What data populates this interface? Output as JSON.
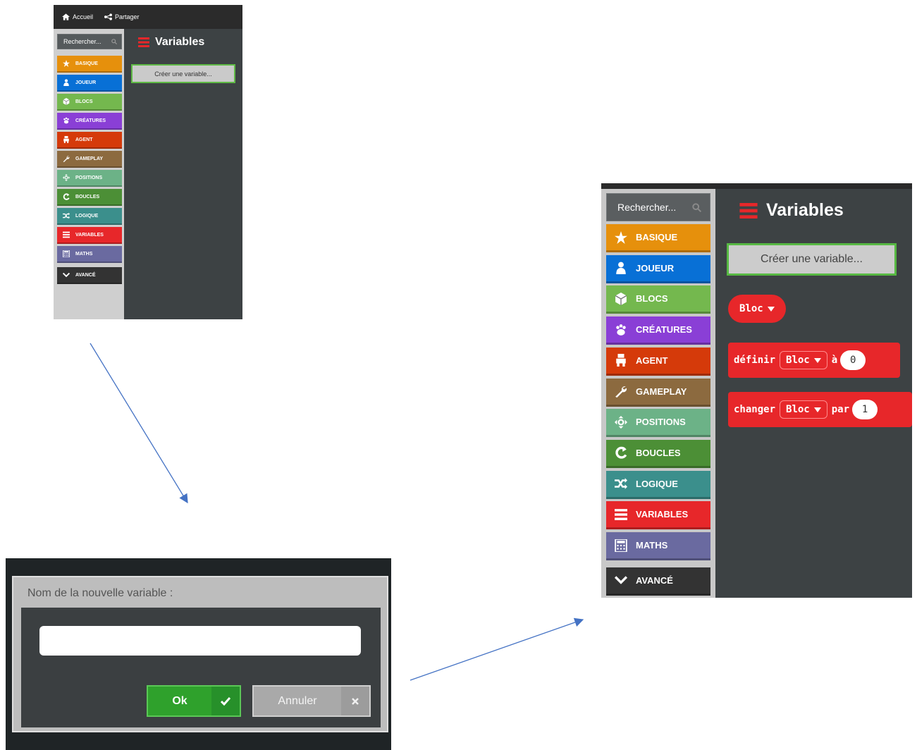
{
  "colors": {
    "basique": "#e6900c",
    "joueur": "#0870d6",
    "blocs": "#74b84e",
    "creatures": "#8a3fd6",
    "agent": "#d53a0a",
    "gameplay": "#8c6a3f",
    "positions": "#6cb287",
    "boucles": "#4c8f36",
    "logique": "#3b8f8c",
    "variables": "#e7272a",
    "maths": "#6a6aa0",
    "avance": "#333333",
    "arrow": "#4472c4"
  },
  "shot1": {
    "topbar": {
      "home_label": "Accueil",
      "share_label": "Partager"
    },
    "search_placeholder": "Rechercher...",
    "categories": [
      {
        "label": "BASIQUE",
        "icon": "star-icon"
      },
      {
        "label": "JOUEUR",
        "icon": "user-icon"
      },
      {
        "label": "BLOCS",
        "icon": "cube-icon"
      },
      {
        "label": "CRÉATURES",
        "icon": "paw-icon"
      },
      {
        "label": "AGENT",
        "icon": "agent-icon"
      },
      {
        "label": "GAMEPLAY",
        "icon": "wrench-icon"
      },
      {
        "label": "POSITIONS",
        "icon": "move-icon"
      },
      {
        "label": "BOUCLES",
        "icon": "loop-icon"
      },
      {
        "label": "LOGIQUE",
        "icon": "shuffle-icon"
      },
      {
        "label": "VARIABLES",
        "icon": "list-icon"
      },
      {
        "label": "MATHS",
        "icon": "calculator-icon"
      },
      {
        "label": "AVANCÉ",
        "icon": "chevron-down-icon"
      }
    ],
    "flyout_title": "Variables",
    "create_button": "Créer une variable..."
  },
  "shot2": {
    "dialog_title": "Nom de la nouvelle variable :",
    "input_value": "",
    "ok_label": "Ok",
    "cancel_label": "Annuler"
  },
  "shot3": {
    "search_placeholder": "Rechercher...",
    "categories": [
      {
        "label": "BASIQUE",
        "icon": "star-icon"
      },
      {
        "label": "JOUEUR",
        "icon": "user-icon"
      },
      {
        "label": "BLOCS",
        "icon": "cube-icon"
      },
      {
        "label": "CRÉATURES",
        "icon": "paw-icon"
      },
      {
        "label": "AGENT",
        "icon": "agent-icon"
      },
      {
        "label": "GAMEPLAY",
        "icon": "wrench-icon"
      },
      {
        "label": "POSITIONS",
        "icon": "move-icon"
      },
      {
        "label": "BOUCLES",
        "icon": "loop-icon"
      },
      {
        "label": "LOGIQUE",
        "icon": "shuffle-icon"
      },
      {
        "label": "VARIABLES",
        "icon": "list-icon"
      },
      {
        "label": "MATHS",
        "icon": "calculator-icon"
      },
      {
        "label": "AVANCÉ",
        "icon": "chevron-down-icon"
      }
    ],
    "flyout_title": "Variables",
    "create_button": "Créer une variable...",
    "blocks": {
      "variable_block": "Bloc",
      "set_keyword": "définir",
      "set_var": "Bloc",
      "set_to": "à",
      "set_value": "0",
      "change_keyword": "changer",
      "change_var": "Bloc",
      "change_by": "par",
      "change_value": "1"
    }
  }
}
